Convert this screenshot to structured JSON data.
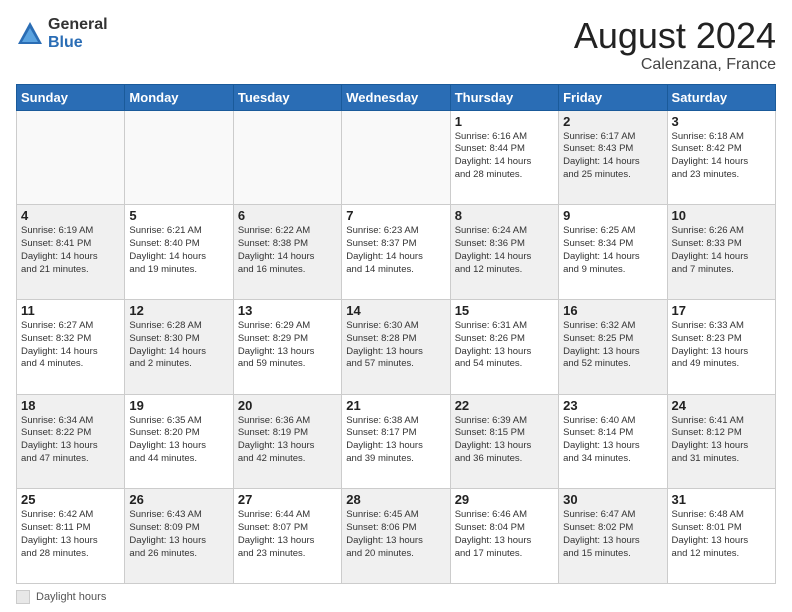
{
  "header": {
    "logo_general": "General",
    "logo_blue": "Blue",
    "month_year": "August 2024",
    "location": "Calenzana, France"
  },
  "footer": {
    "label": "Daylight hours"
  },
  "calendar": {
    "days_of_week": [
      "Sunday",
      "Monday",
      "Tuesday",
      "Wednesday",
      "Thursday",
      "Friday",
      "Saturday"
    ],
    "weeks": [
      [
        {
          "day": "",
          "info": "",
          "empty": true
        },
        {
          "day": "",
          "info": "",
          "empty": true
        },
        {
          "day": "",
          "info": "",
          "empty": true
        },
        {
          "day": "",
          "info": "",
          "empty": true
        },
        {
          "day": "1",
          "info": "Sunrise: 6:16 AM\nSunset: 8:44 PM\nDaylight: 14 hours\nand 28 minutes.",
          "empty": false
        },
        {
          "day": "2",
          "info": "Sunrise: 6:17 AM\nSunset: 8:43 PM\nDaylight: 14 hours\nand 25 minutes.",
          "empty": false
        },
        {
          "day": "3",
          "info": "Sunrise: 6:18 AM\nSunset: 8:42 PM\nDaylight: 14 hours\nand 23 minutes.",
          "empty": false
        }
      ],
      [
        {
          "day": "4",
          "info": "Sunrise: 6:19 AM\nSunset: 8:41 PM\nDaylight: 14 hours\nand 21 minutes.",
          "empty": false
        },
        {
          "day": "5",
          "info": "Sunrise: 6:21 AM\nSunset: 8:40 PM\nDaylight: 14 hours\nand 19 minutes.",
          "empty": false
        },
        {
          "day": "6",
          "info": "Sunrise: 6:22 AM\nSunset: 8:38 PM\nDaylight: 14 hours\nand 16 minutes.",
          "empty": false
        },
        {
          "day": "7",
          "info": "Sunrise: 6:23 AM\nSunset: 8:37 PM\nDaylight: 14 hours\nand 14 minutes.",
          "empty": false
        },
        {
          "day": "8",
          "info": "Sunrise: 6:24 AM\nSunset: 8:36 PM\nDaylight: 14 hours\nand 12 minutes.",
          "empty": false
        },
        {
          "day": "9",
          "info": "Sunrise: 6:25 AM\nSunset: 8:34 PM\nDaylight: 14 hours\nand 9 minutes.",
          "empty": false
        },
        {
          "day": "10",
          "info": "Sunrise: 6:26 AM\nSunset: 8:33 PM\nDaylight: 14 hours\nand 7 minutes.",
          "empty": false
        }
      ],
      [
        {
          "day": "11",
          "info": "Sunrise: 6:27 AM\nSunset: 8:32 PM\nDaylight: 14 hours\nand 4 minutes.",
          "empty": false
        },
        {
          "day": "12",
          "info": "Sunrise: 6:28 AM\nSunset: 8:30 PM\nDaylight: 14 hours\nand 2 minutes.",
          "empty": false
        },
        {
          "day": "13",
          "info": "Sunrise: 6:29 AM\nSunset: 8:29 PM\nDaylight: 13 hours\nand 59 minutes.",
          "empty": false
        },
        {
          "day": "14",
          "info": "Sunrise: 6:30 AM\nSunset: 8:28 PM\nDaylight: 13 hours\nand 57 minutes.",
          "empty": false
        },
        {
          "day": "15",
          "info": "Sunrise: 6:31 AM\nSunset: 8:26 PM\nDaylight: 13 hours\nand 54 minutes.",
          "empty": false
        },
        {
          "day": "16",
          "info": "Sunrise: 6:32 AM\nSunset: 8:25 PM\nDaylight: 13 hours\nand 52 minutes.",
          "empty": false
        },
        {
          "day": "17",
          "info": "Sunrise: 6:33 AM\nSunset: 8:23 PM\nDaylight: 13 hours\nand 49 minutes.",
          "empty": false
        }
      ],
      [
        {
          "day": "18",
          "info": "Sunrise: 6:34 AM\nSunset: 8:22 PM\nDaylight: 13 hours\nand 47 minutes.",
          "empty": false
        },
        {
          "day": "19",
          "info": "Sunrise: 6:35 AM\nSunset: 8:20 PM\nDaylight: 13 hours\nand 44 minutes.",
          "empty": false
        },
        {
          "day": "20",
          "info": "Sunrise: 6:36 AM\nSunset: 8:19 PM\nDaylight: 13 hours\nand 42 minutes.",
          "empty": false
        },
        {
          "day": "21",
          "info": "Sunrise: 6:38 AM\nSunset: 8:17 PM\nDaylight: 13 hours\nand 39 minutes.",
          "empty": false
        },
        {
          "day": "22",
          "info": "Sunrise: 6:39 AM\nSunset: 8:15 PM\nDaylight: 13 hours\nand 36 minutes.",
          "empty": false
        },
        {
          "day": "23",
          "info": "Sunrise: 6:40 AM\nSunset: 8:14 PM\nDaylight: 13 hours\nand 34 minutes.",
          "empty": false
        },
        {
          "day": "24",
          "info": "Sunrise: 6:41 AM\nSunset: 8:12 PM\nDaylight: 13 hours\nand 31 minutes.",
          "empty": false
        }
      ],
      [
        {
          "day": "25",
          "info": "Sunrise: 6:42 AM\nSunset: 8:11 PM\nDaylight: 13 hours\nand 28 minutes.",
          "empty": false
        },
        {
          "day": "26",
          "info": "Sunrise: 6:43 AM\nSunset: 8:09 PM\nDaylight: 13 hours\nand 26 minutes.",
          "empty": false
        },
        {
          "day": "27",
          "info": "Sunrise: 6:44 AM\nSunset: 8:07 PM\nDaylight: 13 hours\nand 23 minutes.",
          "empty": false
        },
        {
          "day": "28",
          "info": "Sunrise: 6:45 AM\nSunset: 8:06 PM\nDaylight: 13 hours\nand 20 minutes.",
          "empty": false
        },
        {
          "day": "29",
          "info": "Sunrise: 6:46 AM\nSunset: 8:04 PM\nDaylight: 13 hours\nand 17 minutes.",
          "empty": false
        },
        {
          "day": "30",
          "info": "Sunrise: 6:47 AM\nSunset: 8:02 PM\nDaylight: 13 hours\nand 15 minutes.",
          "empty": false
        },
        {
          "day": "31",
          "info": "Sunrise: 6:48 AM\nSunset: 8:01 PM\nDaylight: 13 hours\nand 12 minutes.",
          "empty": false
        }
      ]
    ]
  }
}
